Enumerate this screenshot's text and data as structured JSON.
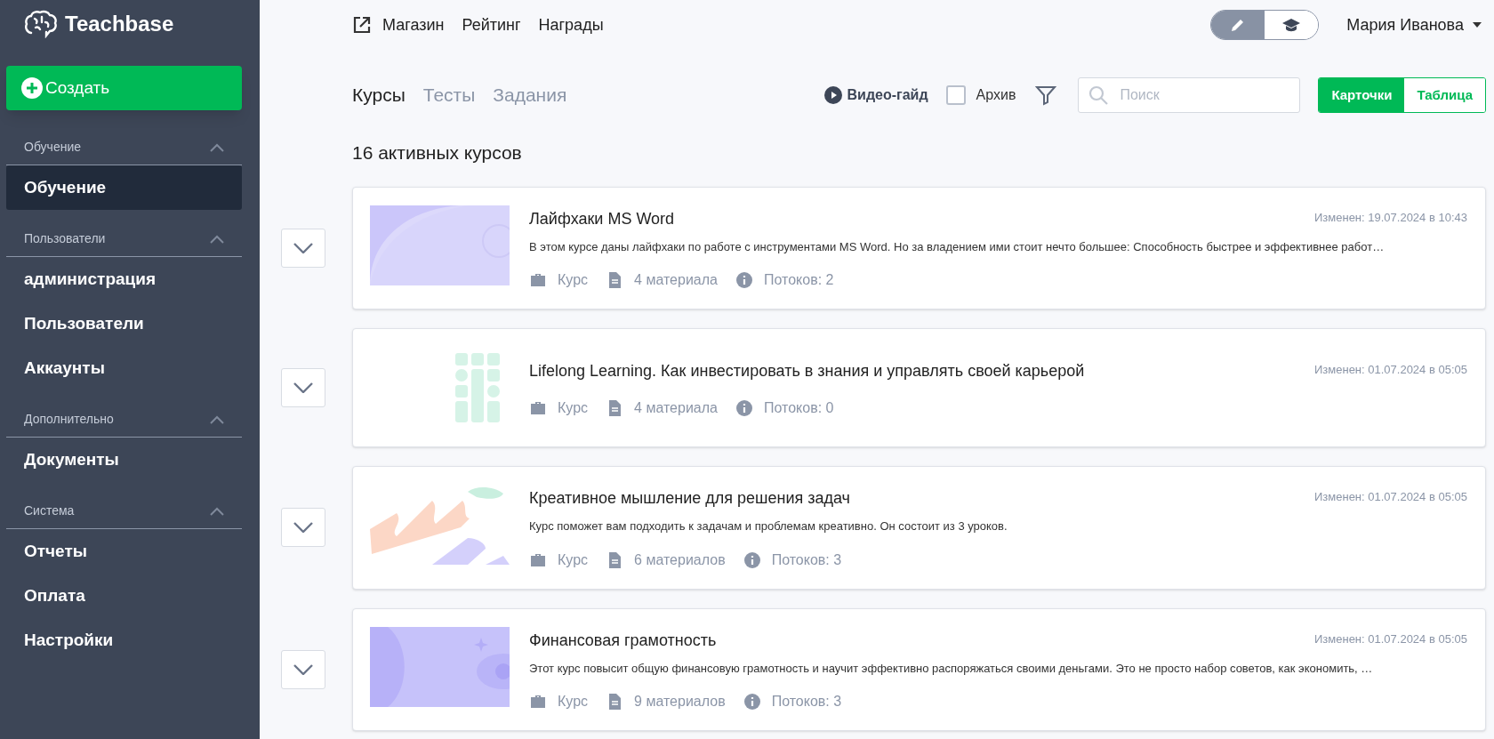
{
  "sidebar": {
    "logo": "Teachbase",
    "create_button": "Создать",
    "sections": [
      {
        "title": "Обучение",
        "expanded": true,
        "items": [
          {
            "label": "Обучение",
            "selected": true
          }
        ]
      },
      {
        "title": "Пользователи",
        "expanded": true,
        "items": [
          {
            "label": "администрация",
            "selected": false
          },
          {
            "label": "Пользователи",
            "selected": false
          },
          {
            "label": "Аккаунты",
            "selected": false
          }
        ]
      },
      {
        "title": "Дополнительно",
        "expanded": true,
        "items": [
          {
            "label": "Документы",
            "selected": false
          }
        ]
      },
      {
        "title": "Система",
        "expanded": true,
        "items": [
          {
            "label": "Отчеты",
            "selected": false
          },
          {
            "label": "Оплата",
            "selected": false
          },
          {
            "label": "Настройки",
            "selected": false
          }
        ]
      }
    ]
  },
  "top_nav": {
    "links": [
      "Магазин",
      "Рейтинг",
      "Награды"
    ],
    "mode_toggle": [
      {
        "kind": "edit",
        "selected": true
      },
      {
        "kind": "learn",
        "selected": false
      }
    ],
    "user": "Мария Иванова"
  },
  "tabs": [
    {
      "label": "Курсы",
      "selected": true
    },
    {
      "label": "Тесты",
      "selected": false
    },
    {
      "label": "Задания",
      "selected": false
    }
  ],
  "toolbar": {
    "video_guide": "Видео-гайд",
    "archive": {
      "label": "Архив",
      "checked": false
    },
    "search": {
      "placeholder": "Поиск"
    },
    "view_switch": [
      {
        "label": "Карточки",
        "selected": true
      },
      {
        "label": "Таблица",
        "selected": false
      }
    ]
  },
  "count_title": "16 активных курсов",
  "courses": [
    {
      "title": "Лайфхаки MS Word",
      "modified": "Изменен: 19.07.2024 в 10:43",
      "description": "В этом курсе даны лайфхаки по работе с инструментами MS Word. Но за владением ими стоит нечто большее: Способность быстрее и эффективнее работ…",
      "type": "Курс",
      "materials": "4 материала",
      "streams": "Потоков: 2"
    },
    {
      "title": "Lifelong Learning. Как инвестировать в знания и управлять своей карьерой",
      "modified": "Изменен: 01.07.2024 в 05:05",
      "type": "Курс",
      "materials": "4 материала",
      "streams": "Потоков: 0"
    },
    {
      "title": "Креативное мышление для решения задач",
      "modified": "Изменен: 01.07.2024 в 05:05",
      "description": "Курс поможет вам подходить к задачам и проблемам креативно. Он состоит из 3 уроков.",
      "type": "Курс",
      "materials": "6 материалов",
      "streams": "Потоков: 3"
    },
    {
      "title": "Финансовая грамотность",
      "modified": "Изменен: 01.07.2024 в 05:05",
      "description": "Этот курс повысит общую финансовую грамотность и научит эффективно распоряжаться своими деньгами. Это не просто набор советов, как экономить, …",
      "type": "Курс",
      "materials": "9 материалов",
      "streams": "Потоков: 3"
    }
  ]
}
